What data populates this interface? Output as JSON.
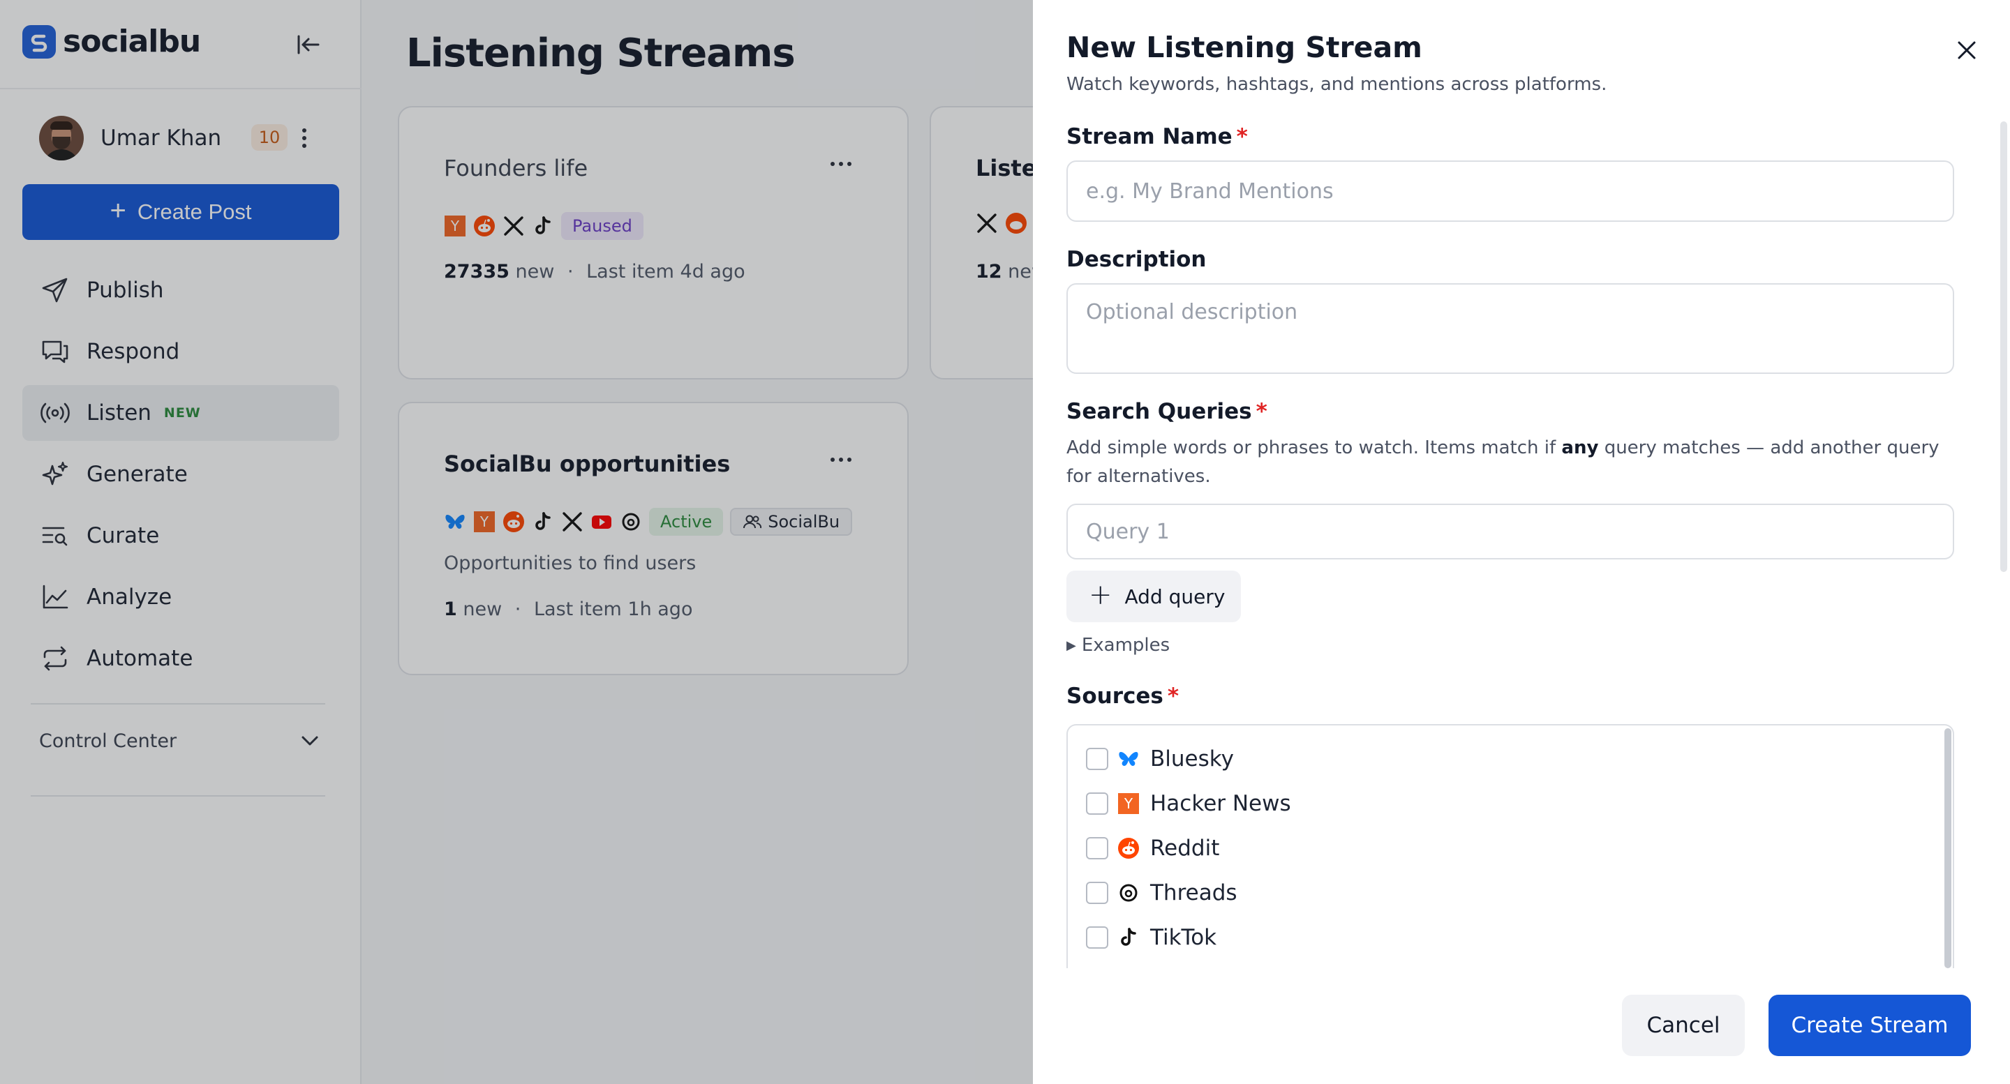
{
  "app": {
    "brand": "socialbu",
    "user": {
      "name": "Umar Khan",
      "badge": "10"
    },
    "create_post_label": "Create Post",
    "nav": [
      {
        "label": "Publish",
        "icon": "send-icon"
      },
      {
        "label": "Respond",
        "icon": "chat-icon"
      },
      {
        "label": "Listen",
        "icon": "broadcast-icon",
        "tag": "NEW",
        "active": true
      },
      {
        "label": "Generate",
        "icon": "sparkle-icon"
      },
      {
        "label": "Curate",
        "icon": "list-search-icon"
      },
      {
        "label": "Analyze",
        "icon": "chart-line-icon"
      },
      {
        "label": "Automate",
        "icon": "repeat-icon"
      }
    ],
    "control_center": "Control Center"
  },
  "page": {
    "title": "Listening Streams",
    "cards": [
      {
        "title": "Founders life",
        "status": "Paused",
        "stats_count": "27335",
        "stats_new": "new",
        "stats_last": "Last item 4d ago"
      },
      {
        "title": "Listen",
        "stats_count": "12",
        "stats_new": "new"
      },
      {
        "title": "SocialBu opportunities",
        "status": "Active",
        "tag": "SocialBu",
        "description": "Opportunities to find users",
        "stats_count": "1",
        "stats_new": "new",
        "stats_last": "Last item 1h ago"
      }
    ]
  },
  "drawer": {
    "title": "New Listening Stream",
    "subtitle": "Watch keywords, hashtags, and mentions across platforms.",
    "stream_name_label": "Stream Name",
    "stream_name_placeholder": "e.g. My Brand Mentions",
    "description_label": "Description",
    "description_placeholder": "Optional description",
    "queries_label": "Search Queries",
    "queries_help_pre": "Add simple words or phrases to watch. Items match if ",
    "queries_help_bold": "any",
    "queries_help_post": " query matches — add another query for alternatives.",
    "query_placeholder": "Query 1",
    "add_query_label": "Add query",
    "examples_label": "Examples",
    "sources_label": "Sources",
    "required_mark": "*",
    "sources": [
      {
        "label": "Bluesky",
        "icon": "bluesky-icon",
        "checked": false
      },
      {
        "label": "Hacker News",
        "icon": "hacker-news-icon",
        "checked": false
      },
      {
        "label": "Reddit",
        "icon": "reddit-icon",
        "checked": false
      },
      {
        "label": "Threads",
        "icon": "threads-icon",
        "checked": false
      },
      {
        "label": "TikTok",
        "icon": "tiktok-icon",
        "checked": false
      }
    ],
    "cancel_label": "Cancel",
    "create_label": "Create Stream"
  },
  "colors": {
    "primary": "#1557d6",
    "required": "#e02424",
    "paused_bg": "#efe8fb",
    "active_bg": "#e6f5e9",
    "hacker_news": "#f26522",
    "reddit": "#ff4500",
    "bluesky": "#1185fe",
    "youtube": "#ff0000"
  }
}
